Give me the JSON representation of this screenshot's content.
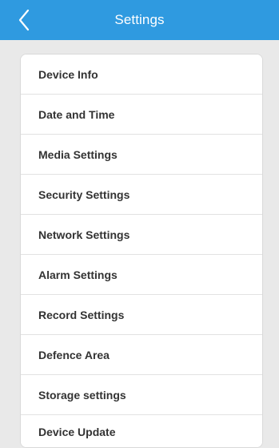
{
  "header": {
    "title": "Settings",
    "back_icon": "chevron-left-icon",
    "background": "#2f9ae0"
  },
  "menu": {
    "items": [
      {
        "label": "Device Info"
      },
      {
        "label": "Date and Time"
      },
      {
        "label": "Media Settings"
      },
      {
        "label": "Security Settings"
      },
      {
        "label": "Network Settings"
      },
      {
        "label": "Alarm Settings"
      },
      {
        "label": "Record Settings"
      },
      {
        "label": "Defence Area"
      },
      {
        "label": "Storage settings"
      },
      {
        "label": "Device Update"
      }
    ]
  }
}
